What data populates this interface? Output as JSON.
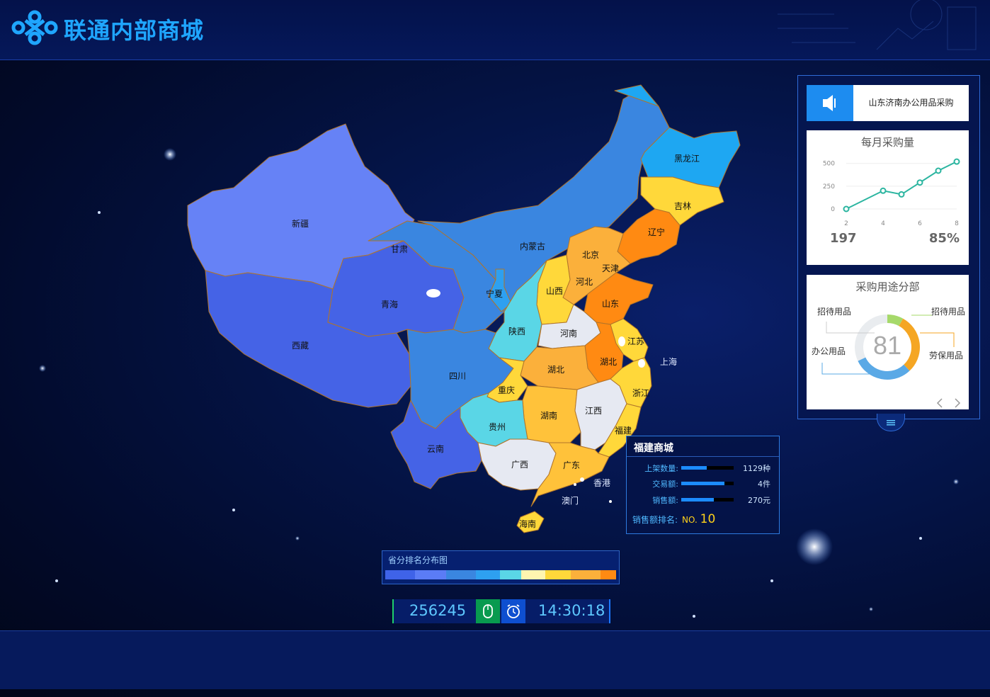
{
  "header": {
    "title": "联通内部商城"
  },
  "map": {
    "labels": {
      "xinjiang": "新疆",
      "xizang": "西藏",
      "qinghai": "青海",
      "gansu": "甘肃",
      "neimenggu": "内蒙古",
      "heilongjiang": "黑龙江",
      "jilin": "吉林",
      "liaoning": "辽宁",
      "beijing": "北京",
      "tianjin": "天津",
      "hebei": "河北",
      "shanxi": "山西",
      "shandong": "山东",
      "ningxia": "宁夏",
      "shaanxi": "陕西",
      "henan": "河南",
      "jiangsu": "江苏",
      "shanghai": "上海",
      "hubei_east": "湖北",
      "anhui_label": "湖北",
      "sichuan": "四川",
      "chongqing": "重庆",
      "zhejiang": "浙江",
      "hunan": "湖南",
      "jiangxi": "江西",
      "guizhou": "贵州",
      "fujian": "福建",
      "yunnan": "云南",
      "guangxi": "广西",
      "guangdong": "广东",
      "xianggang": "香港",
      "aomen": "澳门",
      "hainan": "海南"
    }
  },
  "panel": {
    "notice": "山东济南办公用品采购",
    "monthly": {
      "title": "每月采购量",
      "stat_left": "197",
      "stat_right": "85%"
    },
    "usage": {
      "title": "采购用途分部",
      "center_value": "81",
      "labels": [
        "招待用品",
        "招待用品",
        "办公用品",
        "劳保用品"
      ]
    }
  },
  "chart_data": {
    "type": "line",
    "title": "每月采购量",
    "x": [
      2,
      3,
      4,
      5,
      6,
      7,
      8
    ],
    "series": [
      {
        "values": [
          0,
          100,
          200,
          160,
          290,
          420,
          520
        ]
      }
    ],
    "xticks": [
      "2",
      "4",
      "6",
      "8"
    ],
    "yticks": [
      "0",
      "250",
      "500"
    ],
    "ylim": [
      0,
      560
    ],
    "grid": true
  },
  "donut": {
    "type": "pie",
    "segments": [
      {
        "name": "招待用品",
        "value": 8,
        "color": "#a6d96a"
      },
      {
        "name": "劳保用品",
        "value": 30,
        "color": "#f5a623"
      },
      {
        "name": "办公用品",
        "value": 30,
        "color": "#5aa9e6"
      },
      {
        "name": "招待用品",
        "value": 32,
        "color": "#e9ecef"
      }
    ]
  },
  "tooltip": {
    "title": "福建商城",
    "rows": [
      {
        "label": "上架数量:",
        "value": "1129种",
        "fill": 0.48
      },
      {
        "label": "交易额:",
        "value": "4件",
        "fill": 0.82
      },
      {
        "label": "销售额:",
        "value": "270元",
        "fill": 0.62
      }
    ],
    "rank_label": "销售额排名:",
    "rank_no": "NO.",
    "rank_value": "10"
  },
  "legend": {
    "title": "省分排名分布图",
    "colors": [
      "#3f63e8",
      "#5b7cf5",
      "#3a86e0",
      "#2ea0f0",
      "#5ad6e6",
      "#fff5b0",
      "#ffd83a",
      "#fbb03b",
      "#ff8a12"
    ]
  },
  "counter": {
    "number": "256245",
    "time": "14:30:18"
  },
  "colors": {
    "accent": "#1fa6ff",
    "panel_border": "#2f6bd8"
  }
}
